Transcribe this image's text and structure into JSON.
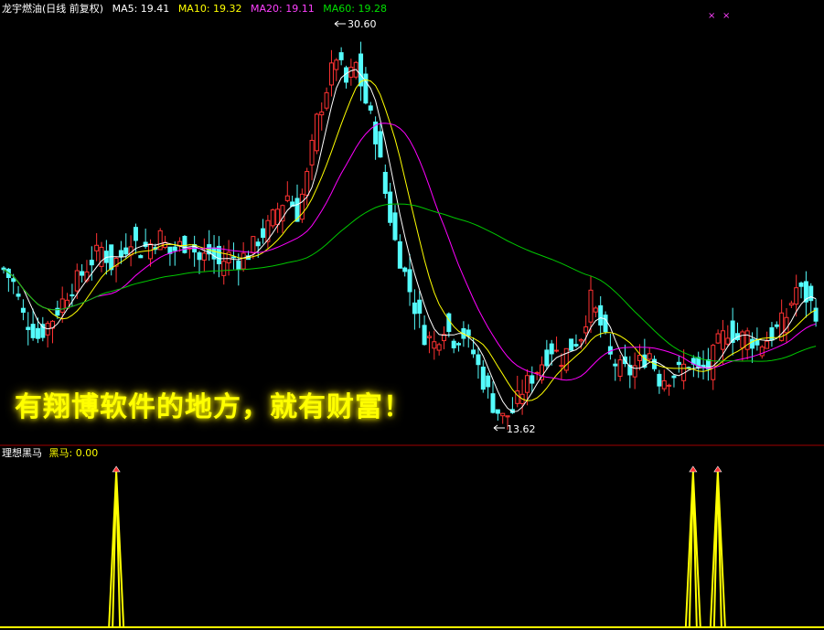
{
  "header": {
    "stock_title": "龙宇燃油(日线 前复权)",
    "ma5_label": "MA5: 19.41",
    "ma10_label": "MA10: 19.32",
    "ma20_label": "MA20: 19.11",
    "ma60_label": "MA60: 19.28"
  },
  "colors": {
    "background": "#000000",
    "up": "#ff3232",
    "down": "#54fcfc",
    "ma5": "#ffffff",
    "ma10": "#ffff00",
    "ma20": "#ff00ff",
    "ma60": "#00c800",
    "divider": "#a00000",
    "indicator": "#ffff00"
  },
  "markers": {
    "cross_a": "×",
    "cross_b": "×"
  },
  "annotations": {
    "high_label": "30.60",
    "low_label": "13.62"
  },
  "banner": {
    "text": "有翔博软件的地方，就有财富！"
  },
  "indicator_panel": {
    "name_label": "理想黑马",
    "series_label": "黑马: 0.00",
    "signal_bars": [
      40,
      250,
      259
    ],
    "bar_count": 300
  },
  "chart_data": {
    "type": "candlestick",
    "title": "龙宇燃油(日线 前复权)",
    "price_high": 30.6,
    "price_low": 13.62,
    "ma_last": {
      "MA5": 19.41,
      "MA10": 19.32,
      "MA20": 19.11,
      "MA60": 19.28
    },
    "close_path": [
      [
        0,
        20.2
      ],
      [
        2,
        19.6
      ],
      [
        4,
        18.2
      ],
      [
        7,
        17.3
      ],
      [
        10,
        18.1
      ],
      [
        13,
        19.2
      ],
      [
        16,
        20.0
      ],
      [
        18,
        20.6
      ],
      [
        20,
        21.1
      ],
      [
        22,
        20.4
      ],
      [
        24,
        20.8
      ],
      [
        26,
        21.6
      ],
      [
        28,
        21.0
      ],
      [
        30,
        21.3
      ],
      [
        32,
        21.6
      ],
      [
        34,
        20.9
      ],
      [
        36,
        21.2
      ],
      [
        38,
        21.4
      ],
      [
        40,
        20.6
      ],
      [
        42,
        20.9
      ],
      [
        44,
        20.4
      ],
      [
        46,
        20.8
      ],
      [
        48,
        20.6
      ],
      [
        50,
        20.9
      ],
      [
        52,
        21.5
      ],
      [
        54,
        22.0
      ],
      [
        56,
        22.8
      ],
      [
        58,
        23.4
      ],
      [
        60,
        22.6
      ],
      [
        62,
        24.2
      ],
      [
        64,
        26.6
      ],
      [
        66,
        28.0
      ],
      [
        68,
        29.4
      ],
      [
        70,
        28.2
      ],
      [
        72,
        29.0
      ],
      [
        74,
        27.4
      ],
      [
        76,
        26.0
      ],
      [
        78,
        23.5
      ],
      [
        80,
        21.4
      ],
      [
        82,
        20.0
      ],
      [
        84,
        18.6
      ],
      [
        86,
        17.4
      ],
      [
        88,
        17.0
      ],
      [
        90,
        17.8
      ],
      [
        92,
        17.2
      ],
      [
        94,
        17.4
      ],
      [
        96,
        16.6
      ],
      [
        98,
        15.4
      ],
      [
        100,
        14.4
      ],
      [
        102,
        13.8
      ],
      [
        104,
        14.1
      ],
      [
        106,
        15.0
      ],
      [
        108,
        15.6
      ],
      [
        110,
        16.2
      ],
      [
        112,
        16.8
      ],
      [
        114,
        16.4
      ],
      [
        116,
        16.9
      ],
      [
        118,
        17.4
      ],
      [
        120,
        18.9
      ],
      [
        122,
        17.8
      ],
      [
        124,
        16.4
      ],
      [
        126,
        15.9
      ],
      [
        128,
        15.8
      ],
      [
        130,
        16.2
      ],
      [
        132,
        16.6
      ],
      [
        134,
        15.5
      ],
      [
        136,
        15.6
      ],
      [
        138,
        15.8
      ],
      [
        140,
        16.2
      ],
      [
        142,
        15.8
      ],
      [
        144,
        16.0
      ],
      [
        146,
        17.0
      ],
      [
        148,
        17.6
      ],
      [
        150,
        17.2
      ],
      [
        152,
        17.4
      ],
      [
        154,
        16.9
      ],
      [
        156,
        17.2
      ],
      [
        158,
        17.6
      ],
      [
        160,
        18.2
      ],
      [
        162,
        19.4
      ],
      [
        164,
        19.0
      ],
      [
        166,
        18.4
      ]
    ]
  }
}
